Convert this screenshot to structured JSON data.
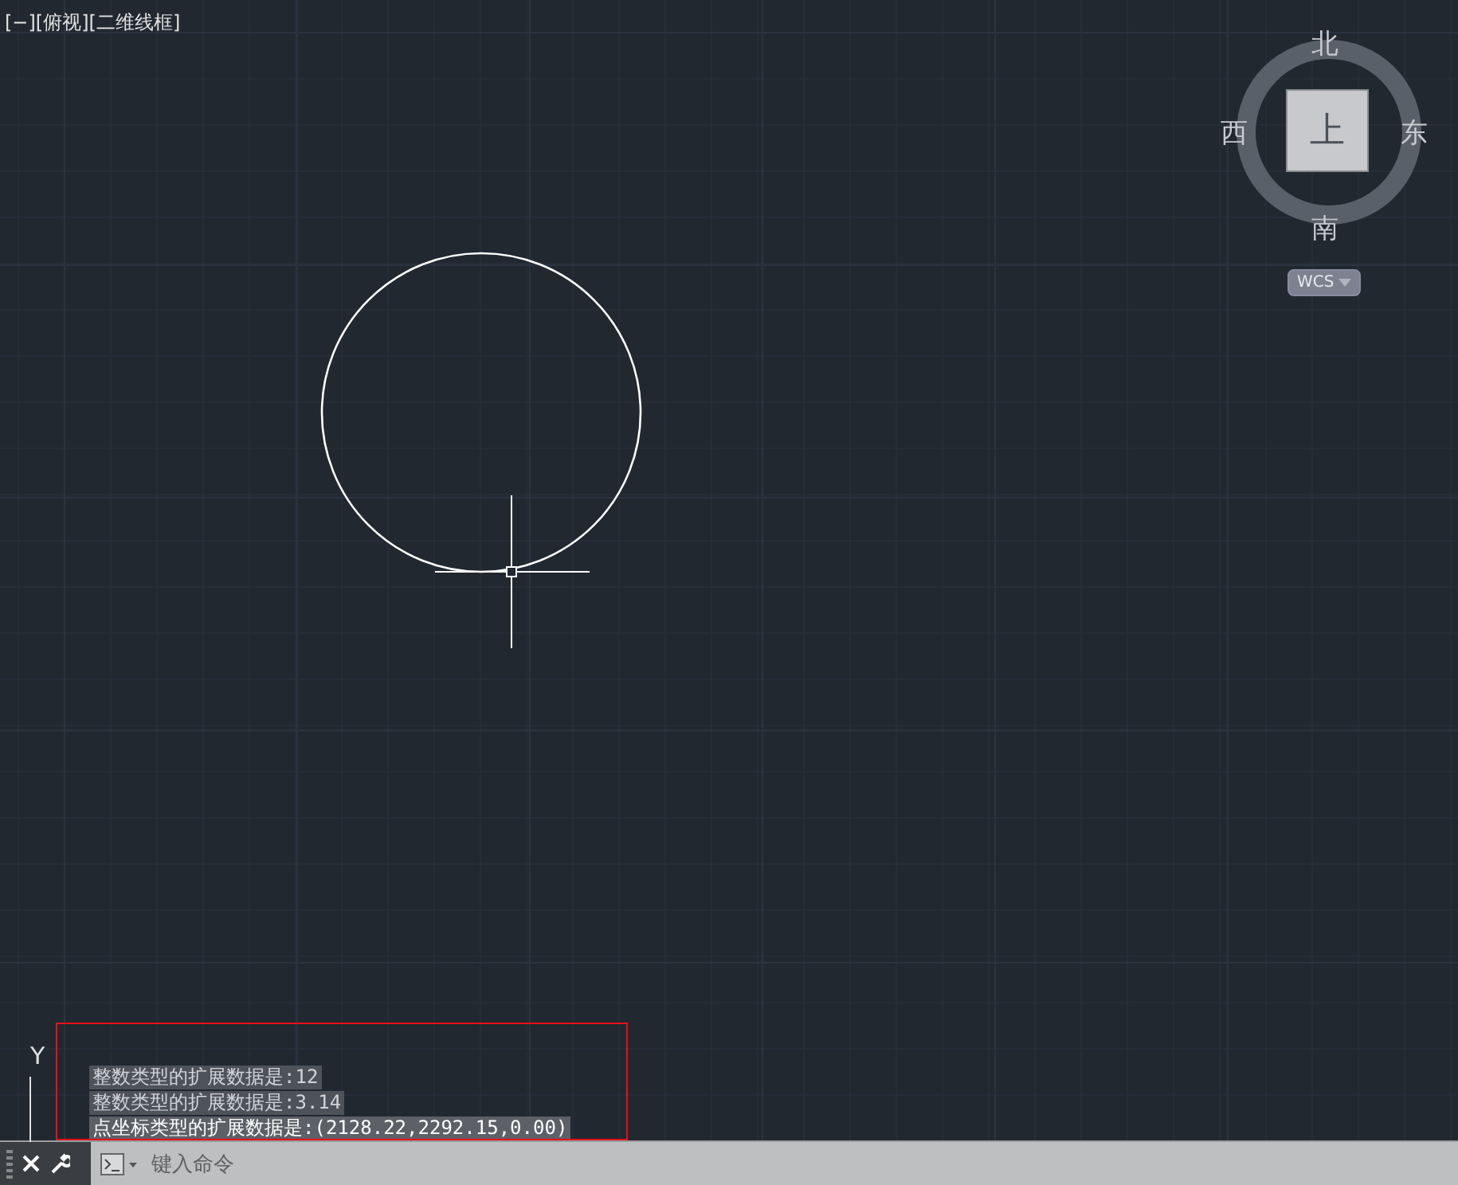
{
  "viewport_label": "[−][俯视][二维线框]",
  "viewcube": {
    "north": "北",
    "south": "南",
    "east": "东",
    "west": "西",
    "face": "上",
    "coordinate_system": "WCS"
  },
  "ucs_icon": {
    "axis": "Y"
  },
  "command_history": [
    "整数类型的扩展数据是:12",
    "整数类型的扩展数据是:3.14",
    "点坐标类型的扩展数据是:(2128.22,2292.15,0.00)"
  ],
  "command_line": {
    "placeholder": "键入命令"
  }
}
